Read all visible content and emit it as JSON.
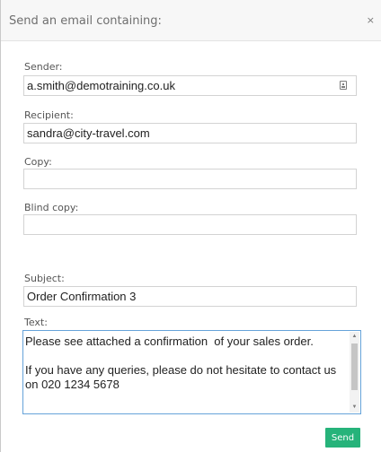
{
  "dialog": {
    "title": "Send an email containing:",
    "close_symbol": "×"
  },
  "form": {
    "sender_label": "Sender:",
    "sender_value": "a.smith@demotraining.co.uk",
    "sender_icon": "contact-card-icon",
    "recipient_label": "Recipient:",
    "recipient_value": "sandra@city-travel.com",
    "copy_label": "Copy:",
    "copy_value": "",
    "blind_copy_label": "Blind copy:",
    "blind_copy_value": "",
    "subject_label": "Subject:",
    "subject_value": "Order Confirmation 3",
    "text_label": "Text:",
    "text_value": "Please see attached a confirmation  of your sales order.\n\nIf you have any queries, please do not hesitate to contact us on 020 1234 5678"
  },
  "actions": {
    "send_label": "Send",
    "send_color": "#26b37a"
  },
  "colors": {
    "header_bg": "#f7f7f7",
    "focus_border": "#66a3d9"
  }
}
